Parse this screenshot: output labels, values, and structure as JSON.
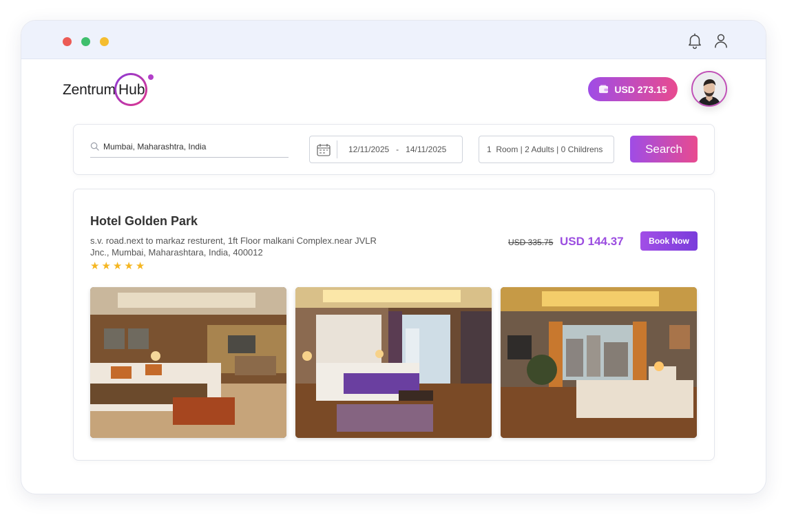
{
  "window": {
    "icons": [
      "bell-icon",
      "user-icon"
    ]
  },
  "logo": {
    "part1": "Zentrum",
    "part2": "Hub"
  },
  "wallet": {
    "amount": "USD 273.15",
    "icon": "wallet-icon"
  },
  "search": {
    "location_value": "Mumbai, Maharashtra, India",
    "check_in": "12/11/2025",
    "date_separator": "-",
    "check_out": "14/11/2025",
    "guests": "1  Room | 2 Adults | 0 Childrens",
    "button_label": "Search"
  },
  "hotel": {
    "name": "Hotel Golden Park",
    "address": "s.v. road.next to markaz resturent, 1ft Floor malkani Complex.near JVLR Jnc., Mumbai, Maharashtara, India, 400012",
    "rating": 5,
    "stars": [
      "★",
      "★",
      "★",
      "★",
      "★"
    ],
    "old_price": "USD 335.75",
    "new_price": "USD 144.37",
    "book_label": "Book Now",
    "photos": [
      "hotel-room-photo",
      "hotel-room-photo",
      "hotel-room-photo"
    ]
  },
  "colors": {
    "accent_start": "#9f4ce6",
    "accent_end": "#e84b8f",
    "price": "#9b4de0",
    "star": "#f5b621"
  }
}
